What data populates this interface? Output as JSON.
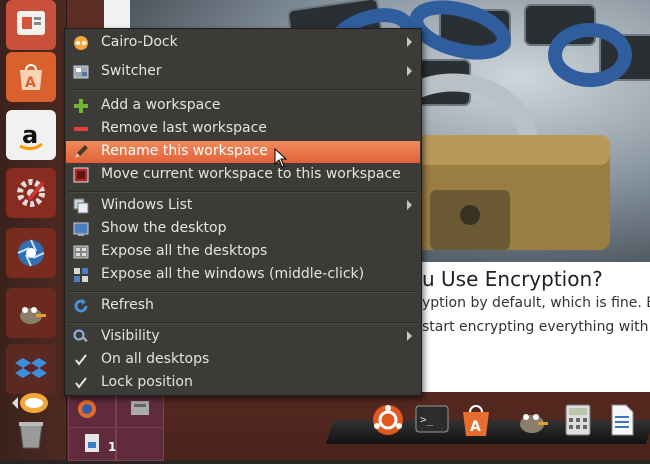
{
  "article": {
    "title": "u Use Encryption?",
    "line1": "yption by default, which is fine. Bu",
    "line2": "start encrypting everything with th"
  },
  "menu": {
    "items": [
      {
        "label": "Cairo-Dock",
        "icon": "cairo-dock-icon",
        "submenu": true
      },
      {
        "label": "Switcher",
        "icon": "switcher-icon",
        "submenu": true
      },
      {
        "label": "Add a workspace",
        "icon": "plus-icon"
      },
      {
        "label": "Remove last workspace",
        "icon": "minus-icon"
      },
      {
        "label": "Rename this workspace",
        "icon": "pencil-icon",
        "highlighted": true
      },
      {
        "label": "Move current workspace to this workspace",
        "icon": "move-workspace-icon"
      },
      {
        "label": "Windows List",
        "icon": "windows-list-icon",
        "submenu": true
      },
      {
        "label": "Show the desktop",
        "icon": "show-desktop-icon"
      },
      {
        "label": "Expose all the desktops",
        "icon": "expose-desktops-icon"
      },
      {
        "label": "Expose all the windows (middle-click)",
        "icon": "expose-windows-icon"
      },
      {
        "label": "Refresh",
        "icon": "refresh-icon"
      },
      {
        "label": "Visibility",
        "icon": "visibility-icon",
        "submenu": true
      },
      {
        "label": "On all desktops",
        "icon": "check-icon"
      },
      {
        "label": "Lock position",
        "icon": "check-icon"
      }
    ]
  },
  "launcher": {
    "apps": [
      "presentation-icon",
      "software-center-icon",
      "amazon-icon",
      "system-settings-icon",
      "shutter-icon",
      "gimp-icon",
      "dropbox-icon",
      "cairo-dock-launcher-icon",
      "trash-icon"
    ]
  },
  "pager": {
    "workspace_number": "1"
  },
  "dock": {
    "apps": [
      "ubuntu-icon",
      "terminal-icon",
      "software-center-dock-icon",
      "gimp-dock-icon",
      "calculator-icon",
      "writer-icon"
    ]
  },
  "colors": {
    "menu_bg": "#3c3b37",
    "highlight": "#e9714a",
    "launcher_bg": "#45261f"
  }
}
